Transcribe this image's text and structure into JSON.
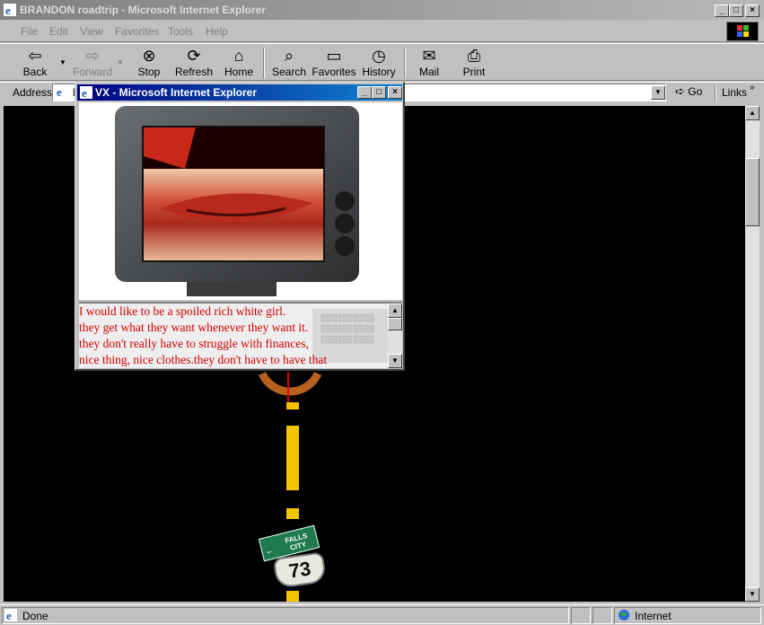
{
  "window": {
    "title": "BRANDON roadtrip - Microsoft Internet Explorer",
    "controls": [
      "_",
      "□",
      "×"
    ]
  },
  "menu": [
    "File",
    "Edit",
    "View",
    "Favorites",
    "Tools",
    "Help"
  ],
  "toolbar": {
    "back": "Back",
    "forward": "Forward",
    "stop": "Stop",
    "refresh": "Refresh",
    "home": "Home",
    "search": "Search",
    "favorites": "Favorites",
    "history": "History",
    "mail": "Mail",
    "print": "Print"
  },
  "address": {
    "label": "Address",
    "value": "h",
    "go": "Go",
    "links": "Links"
  },
  "popup": {
    "title": "VX - Microsoft Internet Explorer",
    "poem_lines": [
      "I would like to be a spoiled rich white girl.",
      "they get what they want whenever they want it.",
      "they don't really have to struggle with finances,",
      "nice thing, nice clothes.they don't have to have that"
    ]
  },
  "sign": {
    "route_number": "73",
    "green_sign": "FALLS CITY"
  },
  "status": {
    "text": "Done",
    "zone": "Internet"
  },
  "colors": {
    "title_active": "#000080",
    "road_line": "#f5c400",
    "poem_text": "#d00000"
  }
}
